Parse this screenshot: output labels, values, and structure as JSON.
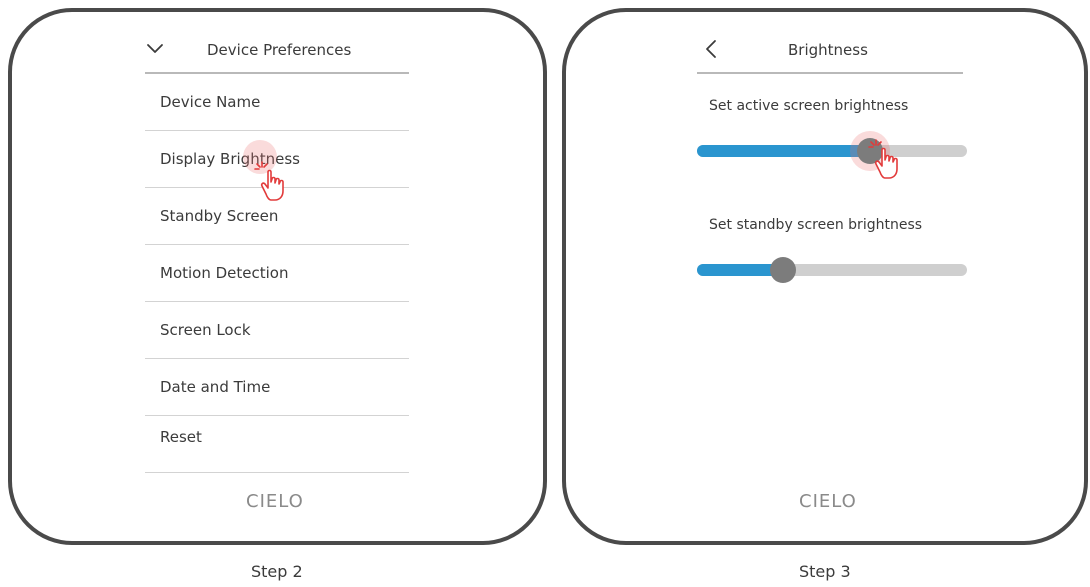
{
  "step_left": {
    "label": "Step 2",
    "header_title": "Device Preferences",
    "menu_items": [
      "Device Name",
      "Display Brightness",
      "Standby Screen",
      "Motion Detection",
      "Screen Lock",
      "Date and Time",
      "Reset"
    ],
    "brand": "CIELO"
  },
  "step_right": {
    "label": "Step 3",
    "header_title": "Brightness",
    "active_label": "Set active screen brightness",
    "active_value": 0.64,
    "standby_label": "Set standby screen brightness",
    "standby_value": 0.32,
    "brand": "CIELO"
  },
  "colors": {
    "slider_fill": "#2a95cf",
    "slider_track": "#cfcfcf",
    "slider_thumb": "#7c7c7c",
    "tap_highlight": "#eb6e6e"
  },
  "icons": [
    "chevron-down-icon",
    "chevron-left-icon",
    "tap-hand-icon"
  ]
}
